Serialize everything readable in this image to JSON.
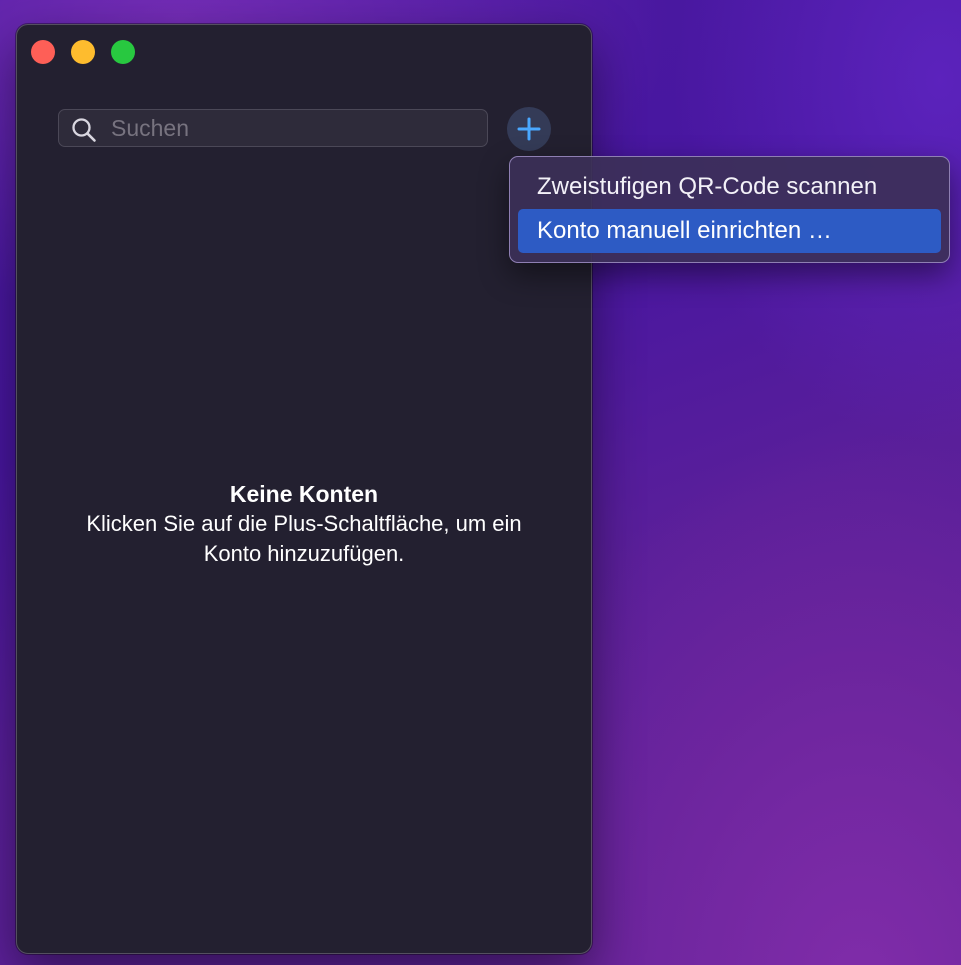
{
  "window": {
    "traffic_lights": [
      "close",
      "minimize",
      "zoom"
    ]
  },
  "search": {
    "placeholder": "Suchen",
    "value": "",
    "icon": "magnifying-glass-icon"
  },
  "add_button": {
    "icon": "plus-icon",
    "color": "#4aa8ff"
  },
  "empty_state": {
    "title": "Keine Konten",
    "description": "Klicken Sie auf die Plus-Schaltfläche, um ein Konto hinzuzufügen."
  },
  "menu": {
    "items": [
      {
        "label": "Zweistufigen QR-Code scannen",
        "selected": false
      },
      {
        "label": "Konto manuell einrichten …",
        "selected": true
      }
    ],
    "highlight_color": "#2d5bc4"
  }
}
